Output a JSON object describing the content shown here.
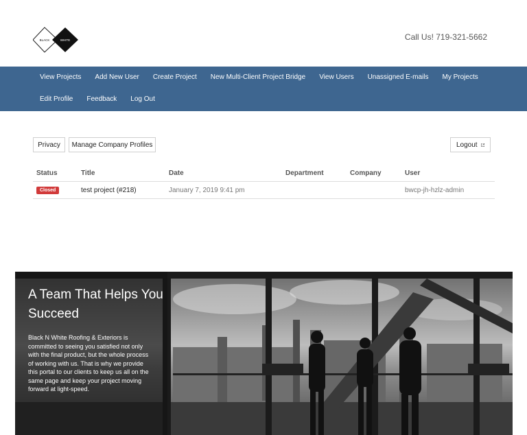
{
  "header": {
    "logo_text_left": "BLACK",
    "logo_text_right": "WHITE",
    "call": "Call Us! 719-321-5662"
  },
  "nav": {
    "row1": [
      "View Projects",
      "Add New User",
      "Create Project",
      "New Multi-Client Project Bridge",
      "View Users",
      "Unassigned E-mails",
      "My Projects"
    ],
    "row2": [
      "Edit Profile",
      "Feedback",
      "Log Out"
    ]
  },
  "toolbar": {
    "privacy_label": "Privacy",
    "manage_label": "Manage Company Profiles",
    "logout_label": "Logout",
    "logout_icon": "external-link-icon"
  },
  "table": {
    "headers": {
      "status": "Status",
      "title": "Title",
      "date": "Date",
      "department": "Department",
      "company": "Company",
      "user": "User"
    },
    "rows": [
      {
        "status": "Closed",
        "title": "test project (#218)",
        "date": "January 7, 2019 9:41 pm",
        "department": "",
        "company": "",
        "user": "bwcp-jh-hzlz-admin"
      }
    ],
    "status_color": "#d13a3a"
  },
  "hero": {
    "title": "A Team That Helps You Succeed",
    "text": "Black N White Roofing & Exteriors is committed to seeing you satisfied not only with the final product, but the whole process of working with us. That is why we provide this portal to our clients to keep us all on the same page and keep your project moving forward at light-speed."
  },
  "colors": {
    "nav": "#3e6690",
    "badge": "#d13a3a"
  }
}
